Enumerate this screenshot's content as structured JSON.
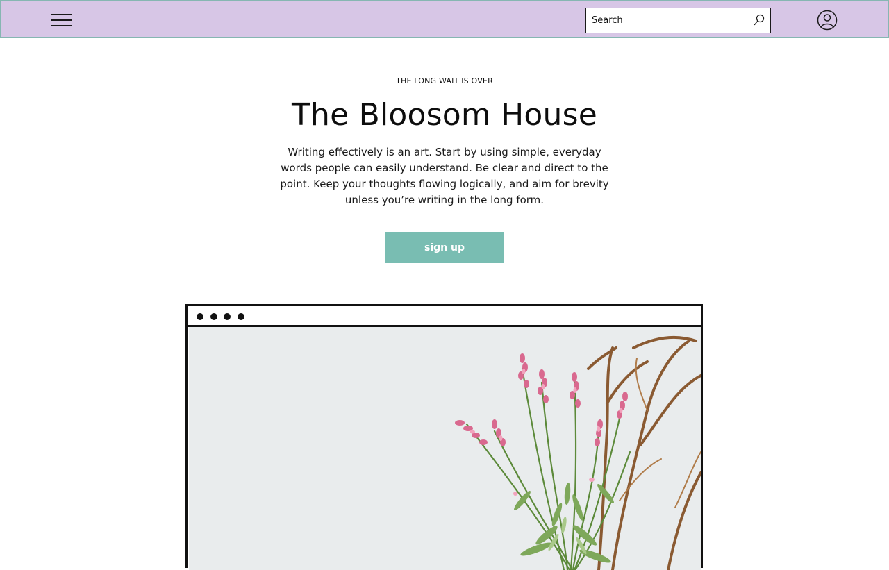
{
  "header": {
    "search_placeholder": "Search",
    "background_color": "#d7c6e6",
    "border_color": "#86b6b2"
  },
  "hero": {
    "eyebrow": "THE LONG WAIT IS OVER",
    "title": "The Bloosom House",
    "body": "Writing effectively is an art. Start by using simple, everyday words people can easily understand. Be clear and direct to the point. Keep your thoughts flowing logically, and aim for brevity unless you’re writing in the long form.",
    "cta_label": "sign up",
    "cta_color": "#79bdb2"
  },
  "icons": {
    "menu": "hamburger-menu-icon",
    "search": "search-icon",
    "account": "user-account-icon"
  }
}
